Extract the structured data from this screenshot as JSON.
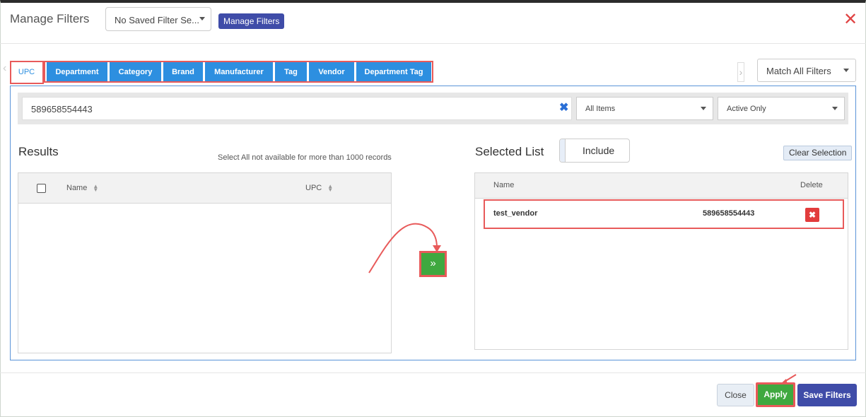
{
  "header": {
    "title": "Manage Filters",
    "saved_filter_value": "No Saved Filter Se...",
    "manage_filters_label": "Manage Filters",
    "close_symbol": "✕"
  },
  "tabs": [
    {
      "label": "UPC",
      "active": true
    },
    {
      "label": "Department",
      "active": false
    },
    {
      "label": "Category",
      "active": false
    },
    {
      "label": "Brand",
      "active": false
    },
    {
      "label": "Manufacturer",
      "active": false
    },
    {
      "label": "Tag",
      "active": false
    },
    {
      "label": "Vendor",
      "active": false
    },
    {
      "label": "Department Tag",
      "active": false
    }
  ],
  "match_filter": {
    "value": "Match All Filters"
  },
  "search": {
    "value": "589658554443",
    "clear_symbol": "✖",
    "items_filter": "All Items",
    "status_filter": "Active Only"
  },
  "results": {
    "title": "Results",
    "note": "Select All not available for more than 1000 records",
    "columns": [
      "Name",
      "UPC"
    ],
    "rows": []
  },
  "move_button": {
    "symbol": "»"
  },
  "selected": {
    "title": "Selected List",
    "toggle_label": "Include",
    "clear_label": "Clear Selection",
    "columns": [
      "Name",
      "Delete"
    ],
    "rows": [
      {
        "name": "test_vendor",
        "upc": "589658554443"
      }
    ],
    "delete_symbol": "✖"
  },
  "footer": {
    "close_label": "Close",
    "apply_label": "Apply",
    "save_label": "Save Filters"
  },
  "colors": {
    "primary_blue": "#2d8fe0",
    "indigo": "#3f4ca8",
    "green": "#3fa83f",
    "annotation_red": "#e85a5a",
    "delete_red": "#e23c3c"
  },
  "icons": {
    "close": "close-icon",
    "clear": "clear-search-icon",
    "move": "double-chevron-right-icon",
    "delete": "delete-icon",
    "sort": "sort-icon",
    "caret": "chevron-down-icon"
  }
}
